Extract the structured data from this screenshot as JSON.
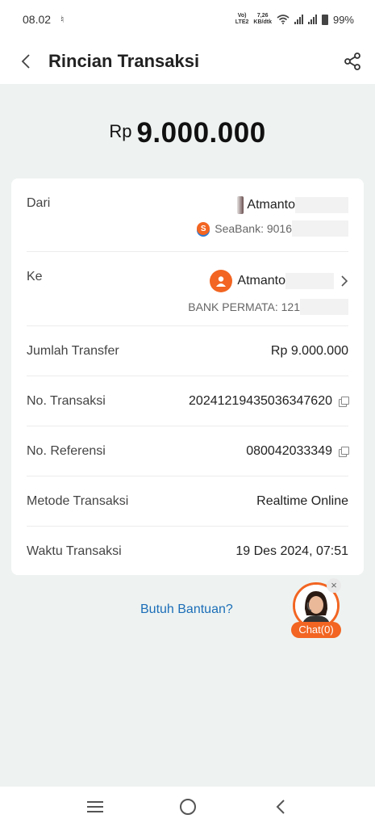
{
  "status_bar": {
    "time": "08.02",
    "network_top": "Vo)",
    "network_bottom": "LTE2",
    "speed_top": "7,26",
    "speed_bottom": "KB/dtk",
    "battery": "99%"
  },
  "header": {
    "title": "Rincian Transaksi",
    "back_icon": "back-icon",
    "share_icon": "share-icon"
  },
  "amount": {
    "currency": "Rp",
    "value": "9.000.000"
  },
  "details": {
    "from": {
      "label": "Dari",
      "name": "Atmanto",
      "bank": "SeaBank: 9016"
    },
    "to": {
      "label": "Ke",
      "name": "Atmanto",
      "bank": "BANK PERMATA: 121"
    },
    "rows": [
      {
        "label": "Jumlah Transfer",
        "value": "Rp 9.000.000"
      },
      {
        "label": "No. Transaksi",
        "value": "20241219435036347620"
      },
      {
        "label": "No. Referensi",
        "value": "080042033349"
      },
      {
        "label": "Metode Transaksi",
        "value": "Realtime Online"
      },
      {
        "label": "Waktu Transaksi",
        "value": "19 Des 2024, 07:51"
      }
    ]
  },
  "help": {
    "label": "Butuh Bantuan?"
  },
  "chat": {
    "label": "Chat(0)",
    "close": "×"
  },
  "colors": {
    "accent": "#f26522",
    "link": "#1c6eb8",
    "background": "#eef3f1"
  }
}
